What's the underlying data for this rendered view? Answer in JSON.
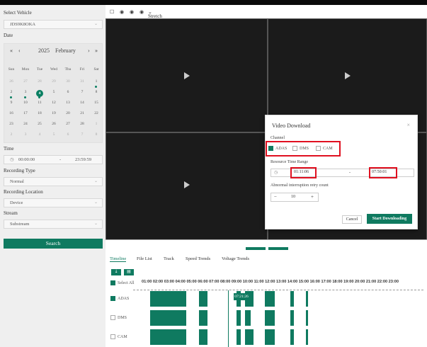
{
  "sidebar": {
    "select_vehicle_label": "Select Vehicle",
    "vehicle_value": "JDS9K8OKA",
    "date_label": "Date",
    "calendar": {
      "year": "2025",
      "month": "February",
      "weekdays": [
        "Sun",
        "Mon",
        "Tue",
        "Wed",
        "Thu",
        "Fri",
        "Sat"
      ],
      "weeks": [
        [
          "26",
          "27",
          "28",
          "29",
          "30",
          "31",
          "1"
        ],
        [
          "2",
          "3",
          "4",
          "5",
          "6",
          "7",
          "8"
        ],
        [
          "9",
          "10",
          "11",
          "12",
          "13",
          "14",
          "15"
        ],
        [
          "16",
          "17",
          "18",
          "19",
          "20",
          "21",
          "22"
        ],
        [
          "23",
          "24",
          "25",
          "26",
          "27",
          "28",
          "1"
        ],
        [
          "2",
          "3",
          "4",
          "5",
          "6",
          "7",
          "8"
        ]
      ],
      "selected_day": "4"
    },
    "time_label": "Time",
    "time_start": "00:00:00",
    "time_sep": "-",
    "time_end": "23:59:59",
    "recording_type_label": "Recording Type",
    "recording_type_value": "Normal",
    "recording_location_label": "Recording Location",
    "recording_location_value": "Device",
    "stream_label": "Stream",
    "stream_value": "Substream",
    "search_button": "Search"
  },
  "video_toolbar": {
    "stretch_label": "Stretch"
  },
  "tabs": [
    "Timeline",
    "File List",
    "Track",
    "Speed Trends",
    "Voltage Trends"
  ],
  "timeline": {
    "select_all": "Select All",
    "hours": "01:00 02:00 03:00 04:00 05:00 06:00 07:00 08:00 09:00 10:00 11:00 12:00 13:00 14:00 15:00 16:00 17:00 18:00 19:00 20:00 21:00 22:00 23:00",
    "cursor_time": "07:21:26",
    "channels": [
      "ADAS",
      "DMS",
      "CAM"
    ]
  },
  "dialog": {
    "title": "Video Download",
    "close": "×",
    "channel_label": "Channel",
    "channels": [
      {
        "name": "ADAS",
        "checked": true
      },
      {
        "name": "DMS",
        "checked": false
      },
      {
        "name": "CAM",
        "checked": false
      }
    ],
    "range_label": "Resource Time Range",
    "range_start": "01:11:06",
    "range_sep": "-",
    "range_end": "07:50:01",
    "retry_label": "Abnormal interruption retry count",
    "retry_minus": "−",
    "retry_value": "10",
    "retry_plus": "+",
    "cancel_button": "Cancel",
    "start_button": "Start Downloading"
  },
  "colors": {
    "accent": "#0f7a60",
    "highlight": "#e01020"
  }
}
